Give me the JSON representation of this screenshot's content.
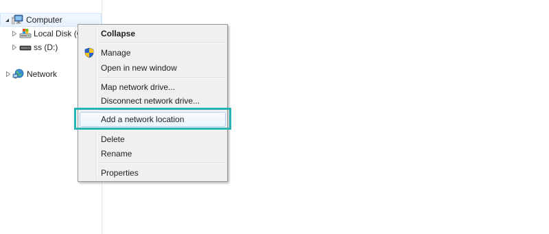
{
  "tree": {
    "computer": {
      "label": "Computer",
      "icon": "computer-icon",
      "expanded": true
    },
    "local_disk": {
      "label": "Local Disk (C:)",
      "icon": "drive-icon"
    },
    "ss_drive": {
      "label": "ss (D:)",
      "icon": "drive-icon"
    },
    "network": {
      "label": "Network",
      "icon": "network-icon"
    }
  },
  "context_menu": {
    "collapse": "Collapse",
    "manage": "Manage",
    "open_new_window": "Open in new window",
    "map_network_drive": "Map network drive...",
    "disconnect_network_drive": "Disconnect network drive...",
    "add_network_location": "Add a network location",
    "delete": "Delete",
    "rename": "Rename",
    "properties": "Properties"
  },
  "colors": {
    "highlight": "#25b3b3",
    "menu_background": "#f0f0f0",
    "hover_border": "#aecff7"
  }
}
